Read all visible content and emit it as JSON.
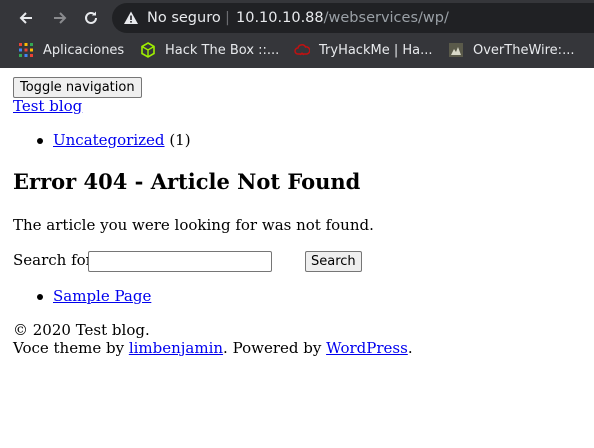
{
  "browser": {
    "security_label": "No seguro",
    "url_host": "10.10.10.88",
    "url_path": "/webservices/wp/",
    "bookmarks": [
      {
        "label": "Aplicaciones",
        "icon": "apps-grid-icon"
      },
      {
        "label": "Hack The Box ::...",
        "icon": "hackthebox-cube-icon"
      },
      {
        "label": "TryHackMe | Ha...",
        "icon": "tryhackme-cloud-icon"
      },
      {
        "label": "OverTheWire:...",
        "icon": "overthewire-icon"
      }
    ]
  },
  "page": {
    "toggle_label": "Toggle navigation",
    "site_title": "Test blog",
    "category_link": "Uncategorized",
    "category_count": "(1)",
    "heading": "Error 404 - Article Not Found",
    "message": "The article you were looking for was not found.",
    "search_label": "Search for:",
    "search_value": "",
    "search_button": "Search",
    "page_link": "Sample Page",
    "copyright": "© 2020 Test blog.",
    "footer_prefix": "Voce theme by ",
    "theme_author": "limbenjamin",
    "footer_mid": ". Powered by ",
    "powered_by": "WordPress",
    "footer_end": "."
  },
  "colors": {
    "chrome_bg": "#35363a",
    "omnibox_bg": "#202124",
    "link": "#0000ee"
  }
}
